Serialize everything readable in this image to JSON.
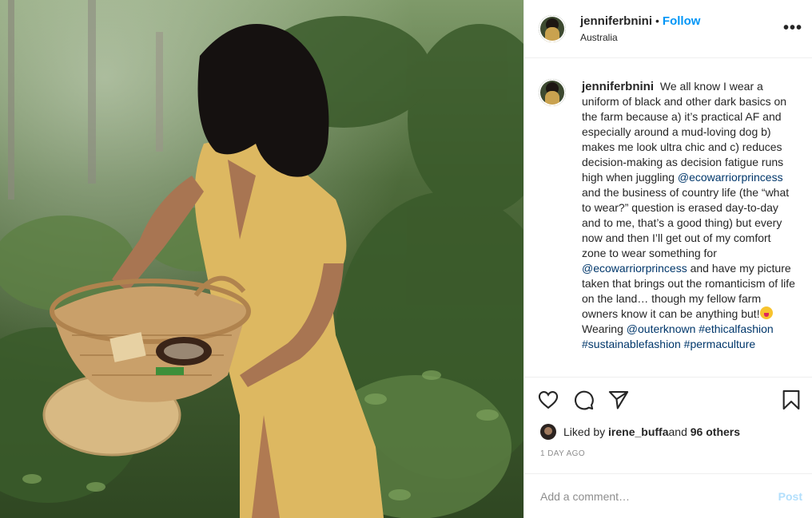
{
  "post": {
    "username": "jenniferbnini",
    "follow_label": "Follow",
    "location": "Australia",
    "more_label": "•••"
  },
  "caption": {
    "username": "jenniferbnini",
    "part1": "We all know I wear a uniform of black and other dark basics on the farm because a) it’s practical AF and especially around a mud-loving dog b) makes me look ultra chic and c) reduces decision-making as decision fatigue runs high when juggling ",
    "mention1": "@ecowarriorprincess",
    "part2": " and the business of country life (the “what to wear?” question is erased day-to-day and to me, that’s a good thing) but every now and then I’ll get out of my comfort zone to wear something for ",
    "mention2": "@ecowarriorprincess",
    "part3": " and have my picture taken that brings out the romanticism of life on the land… though my fellow farm owners know it can be anything but!",
    "part4": "Wearing ",
    "mention3": "@outerknown",
    "tag1": "#ethicalfashion",
    "tag2": "#sustainablefashion",
    "tag3": "#permaculture"
  },
  "likes": {
    "prefix": "Liked by ",
    "user": "irene_buffa",
    "middle": " and ",
    "others": "96 others"
  },
  "timestamp": "1 DAY AGO",
  "comment_box": {
    "placeholder": "Add a comment…",
    "post_label": "Post"
  },
  "icons": {
    "like": "heart-icon",
    "comment": "comment-icon",
    "share": "paper-plane-icon",
    "save": "bookmark-icon",
    "more": "more-dots-icon"
  },
  "colors": {
    "follow": "#0095f6",
    "link": "#00376b",
    "post_disabled": "#b2dffc",
    "muted": "#8e8e8e"
  }
}
